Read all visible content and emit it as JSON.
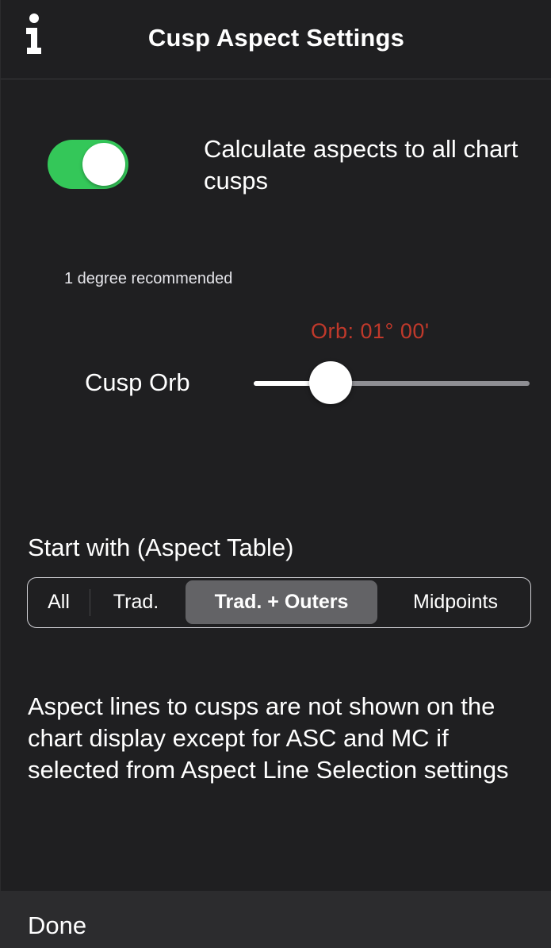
{
  "header": {
    "title": "Cusp Aspect Settings",
    "info_icon": "info-icon"
  },
  "cusps_toggle": {
    "label": "Calculate aspects to all chart cusps",
    "on": true,
    "on_color": "#34c759"
  },
  "orb": {
    "hint": "1 degree recommended",
    "value_text": "Orb: 01° 00'",
    "value_color": "#c0392b",
    "label": "Cusp Orb",
    "slider_fraction": 0.28
  },
  "aspect_table": {
    "label": "Start with (Aspect Table)",
    "options": [
      "All",
      "Trad.",
      "Trad. + Outers",
      "Midpoints"
    ],
    "selected": "Trad. + Outers"
  },
  "note": "Aspect lines to cusps are not shown on the chart display except for ASC and MC if selected from Aspect Line Selection settings",
  "footer": {
    "done_label": "Done"
  }
}
